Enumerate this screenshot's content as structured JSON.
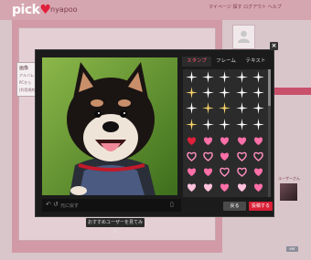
{
  "header": {
    "logo": "pick",
    "username": "nyapoo",
    "links": "マイページ  探す  ログアウト  ヘルプ"
  },
  "side_card": {
    "title": "画像",
    "line1": "アルバム",
    "line2": "PCから",
    "line3": "(利用規約)"
  },
  "side_note": "ユーザーさん",
  "modal": {
    "close_label": "×",
    "tabs": [
      {
        "label": "スタンプ",
        "active": true
      },
      {
        "label": "フレーム",
        "active": false
      },
      {
        "label": "テキスト",
        "active": false
      }
    ],
    "photo_toolbar_label": "元に戻す",
    "prev_button": "戻る",
    "post_button": "投稿する",
    "recommend_button": "おすすめユーザーを見てみる"
  },
  "version_label": "ver",
  "stamp_grid": {
    "rows": [
      [
        "sparkle-white",
        "sparkle-white",
        "sparkle-white",
        "sparkle-white",
        "sparkle-white"
      ],
      [
        "sparkle-gold",
        "sparkle-white",
        "sparkle-white",
        "sparkle-white",
        "sparkle-white"
      ],
      [
        "sparkle-white",
        "sparkle-gold",
        "sparkle-gold",
        "sparkle-white",
        "sparkle-white"
      ],
      [
        "sparkle-gold",
        "sparkle-white",
        "sparkle-white",
        "sparkle-white",
        "sparkle-white"
      ],
      [
        "heart-red",
        "heart-pink",
        "heart-pink",
        "heart-pink",
        "heart-pink"
      ],
      [
        "heart-outline",
        "heart-outline",
        "heart-pink",
        "heart-outline",
        "heart-outline"
      ],
      [
        "heart-pink",
        "heart-pink",
        "heart-outline",
        "heart-outline",
        "heart-pink"
      ],
      [
        "heart-light",
        "heart-light",
        "heart-pink",
        "heart-light",
        "heart-pink"
      ]
    ]
  },
  "colors": {
    "accent": "#d81f36",
    "tab_active": "#ff5a74",
    "modal_bg": "#1b1b1b",
    "heart_pink": "#ff6fa8",
    "heart_red": "#e0203a"
  }
}
